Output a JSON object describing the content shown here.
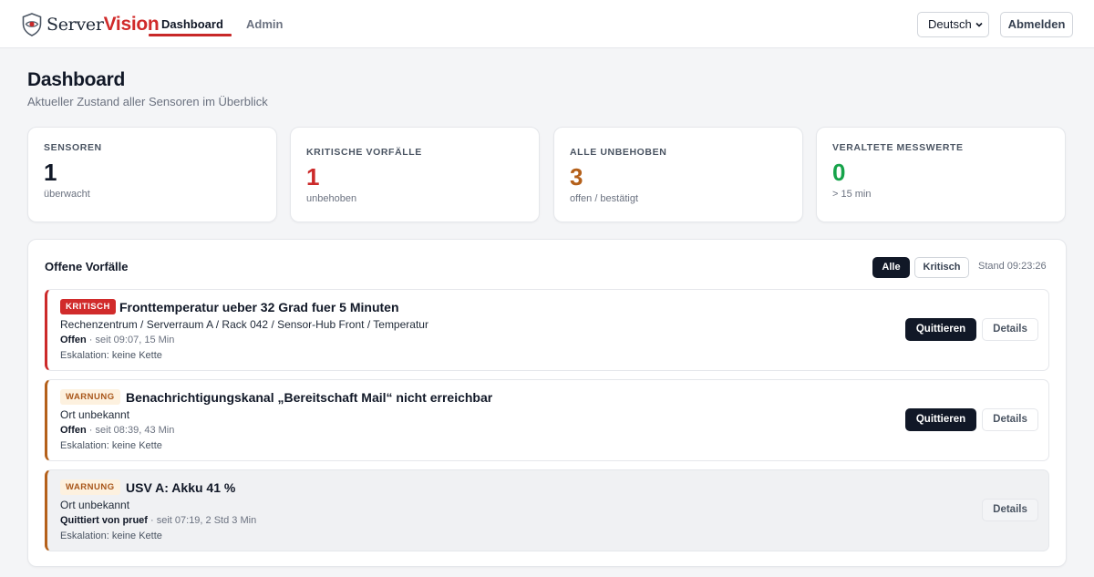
{
  "header": {
    "logo_server": "Server",
    "logo_vision": "Vision",
    "tabs": [
      {
        "label": "Dashboard",
        "active": true
      },
      {
        "label": "Admin",
        "active": false
      }
    ],
    "language": "Deutsch",
    "logout_label": "Abmelden"
  },
  "page": {
    "title": "Dashboard",
    "subtitle": "Aktueller Zustand aller Sensoren im Überblick"
  },
  "stats": [
    {
      "label": "SENSOREN",
      "value": "1",
      "sub": "überwacht",
      "color": "#111827"
    },
    {
      "label": "KRITISCHE VORFÄLLE",
      "value": "1",
      "sub": "unbehoben",
      "color": "#cc2a2a"
    },
    {
      "label": "ALLE UNBEHOBEN",
      "value": "3",
      "sub": "offen / bestätigt",
      "color": "#b4601a"
    },
    {
      "label": "VERALTETE MESSWERTE",
      "value": "0",
      "sub": "> 15 min",
      "color": "#16a34a"
    }
  ],
  "incidents_panel": {
    "title": "Offene Vorfälle",
    "filter_all": "Alle",
    "filter_critical": "Kritisch",
    "stand": "Stand 09:23:26",
    "incidents": [
      {
        "severity": "KRITISCH",
        "title": "Fronttemperatur ueber 32 Grad fuer 5 Minuten",
        "location": "Rechenzentrum / Serverraum A / Rack 042 / Sensor-Hub Front / Temperatur",
        "status": "Offen",
        "since": " · seit 09:07, 15 Min",
        "escalation": "Eskalation: keine Kette",
        "ack_label": "Quittieren",
        "details_label": "Details"
      },
      {
        "severity": "WARNUNG",
        "title": "Benachrichtigungskanal „Bereitschaft Mail“ nicht erreichbar",
        "location": "Ort unbekannt",
        "status": "Offen",
        "since": " · seit 08:39, 43 Min",
        "escalation": "Eskalation: keine Kette",
        "ack_label": "Quittieren",
        "details_label": "Details"
      },
      {
        "severity": "WARNUNG",
        "title": "USV A: Akku 41 %",
        "location": "Ort unbekannt",
        "status": "Quittiert von pruef",
        "since": " · seit 07:19, 2 Std 3 Min",
        "escalation": "Eskalation: keine Kette",
        "details_label": "Details"
      }
    ]
  },
  "colors": {
    "accent_red": "#c82828",
    "critical": "#d12b2b",
    "warning": "#b4601a",
    "ok": "#16a34a",
    "dark": "#111827"
  }
}
